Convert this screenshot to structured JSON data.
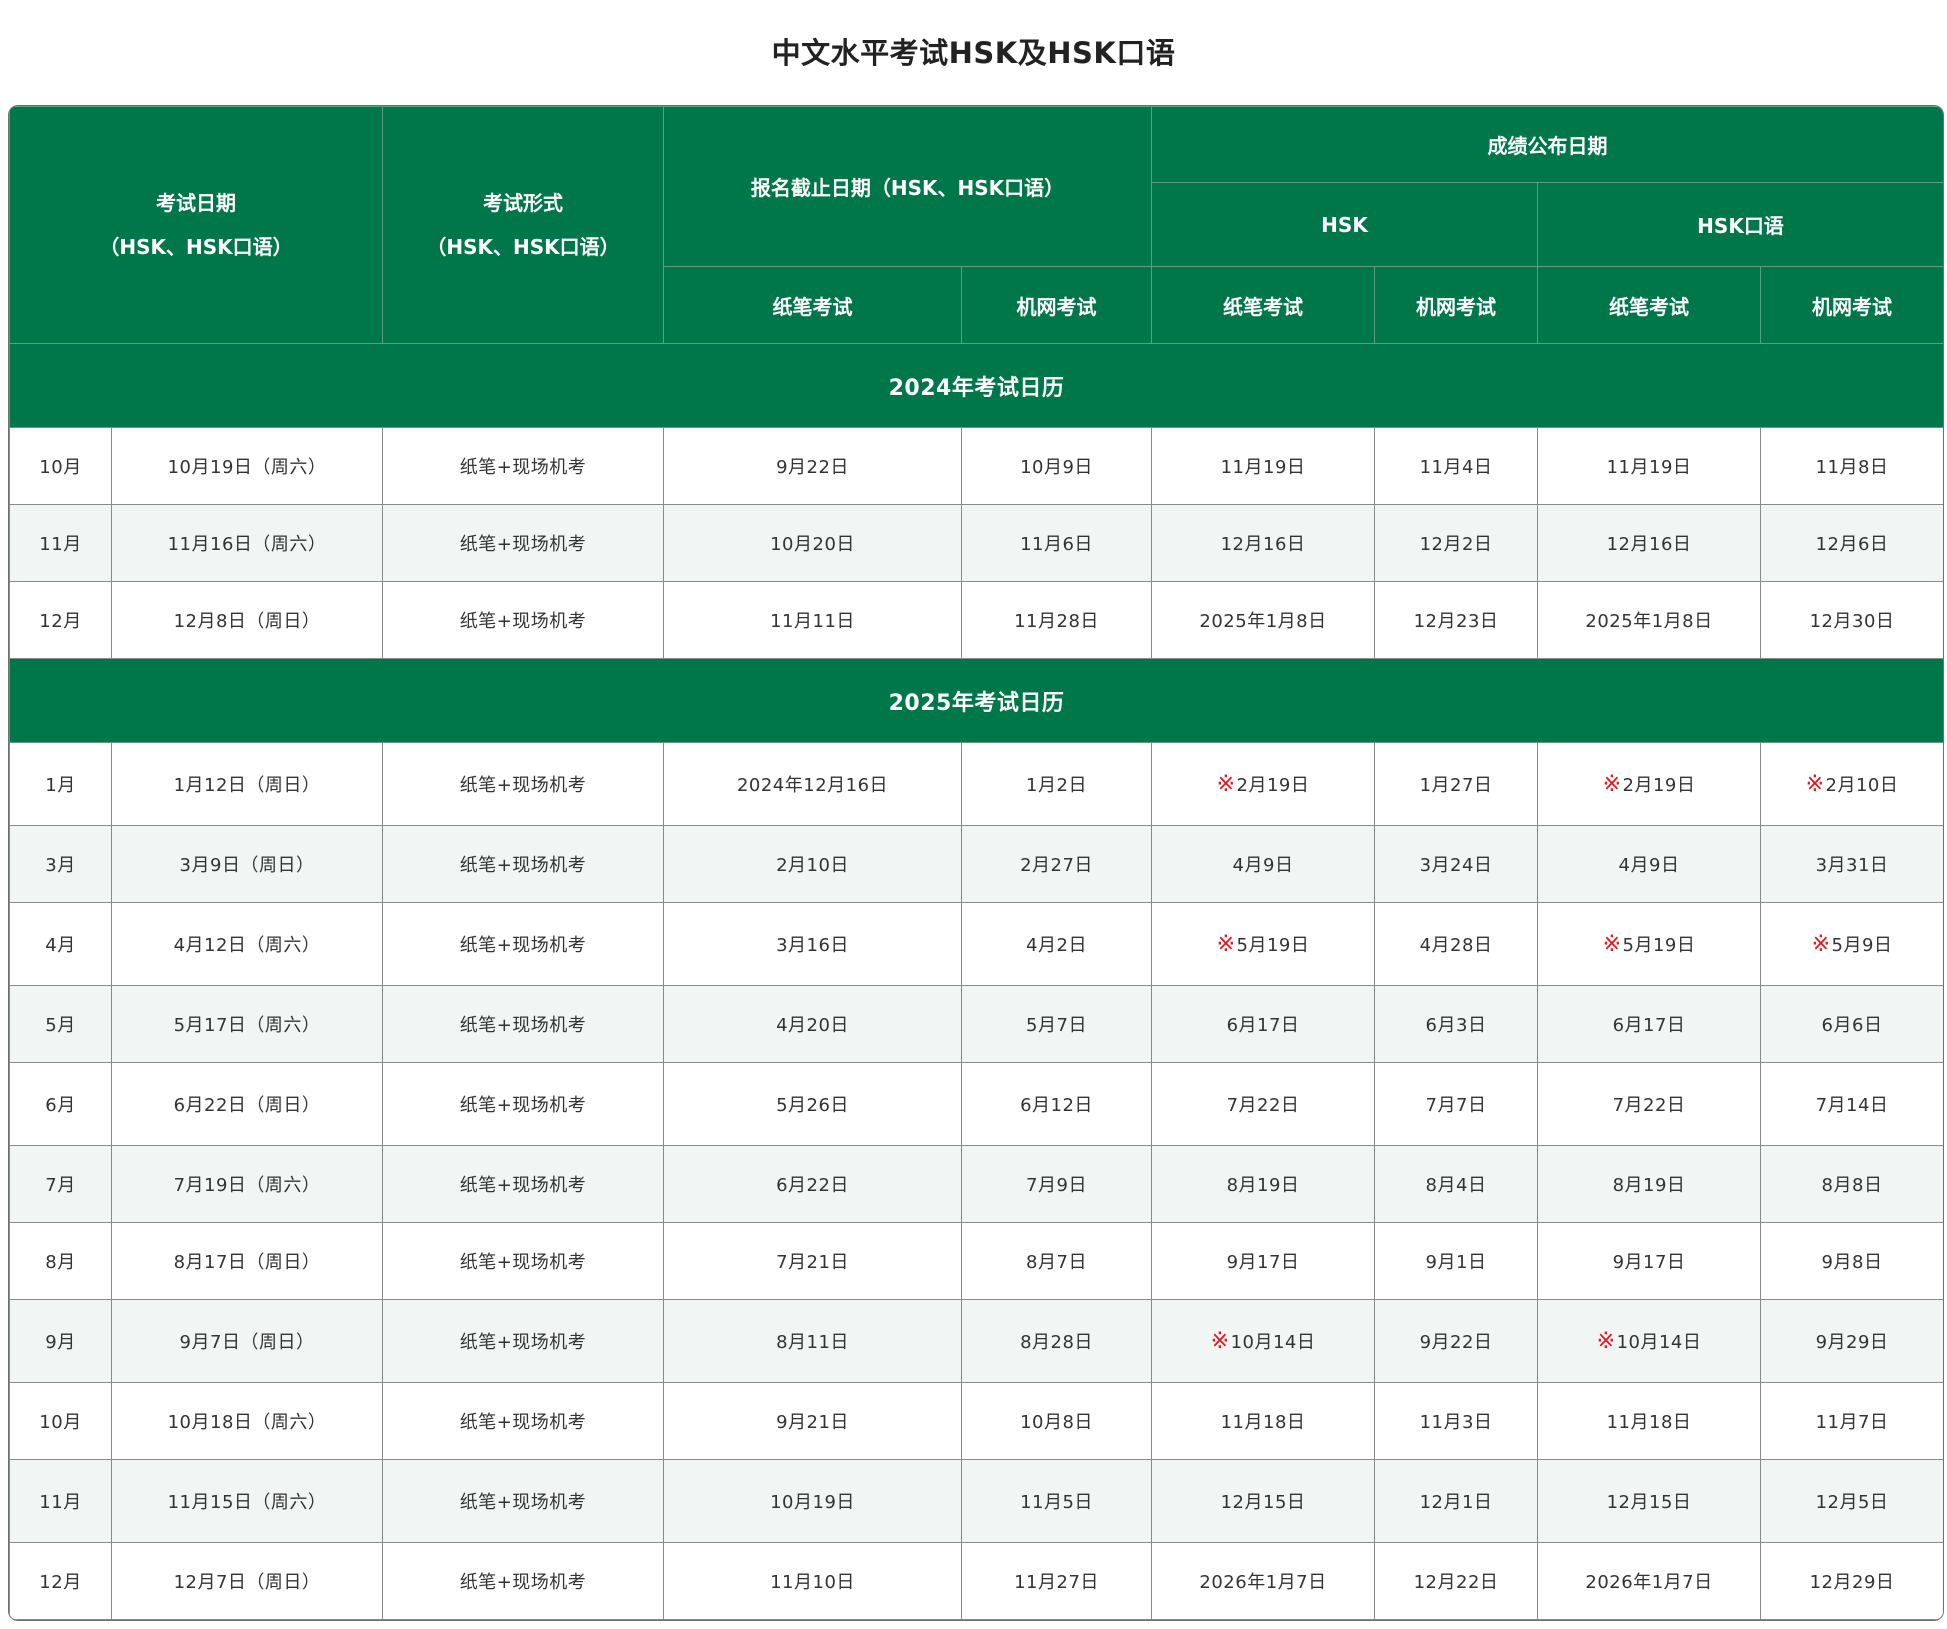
{
  "title": "中文水平考试HSK及HSK口语",
  "header": {
    "exam_date": "考试日期",
    "exam_date_sub": "（HSK、HSK口语）",
    "exam_format": "考试形式",
    "exam_format_sub": "（HSK、HSK口语）",
    "deadline": "报名截止日期（HSK、HSK口语）",
    "results": "成绩公布日期",
    "hsk": "HSK",
    "hsk_oral": "HSK口语",
    "paper": "纸笔考试",
    "online": "机网考试"
  },
  "sections": [
    {
      "year_label": "2024年考试日历",
      "rows": [
        {
          "month": "10月",
          "date": "10月19日（周六）",
          "format": "纸笔+现场机考",
          "dl_paper": "9月22日",
          "dl_online": "10月9日",
          "hsk_paper": "11月19日",
          "hsk_online": "11月4日",
          "oral_paper": "11月19日",
          "oral_online": "11月8日"
        },
        {
          "month": "11月",
          "date": "11月16日（周六）",
          "format": "纸笔+现场机考",
          "dl_paper": "10月20日",
          "dl_online": "11月6日",
          "hsk_paper": "12月16日",
          "hsk_online": "12月2日",
          "oral_paper": "12月16日",
          "oral_online": "12月6日"
        },
        {
          "month": "12月",
          "date": "12月8日（周日）",
          "format": "纸笔+现场机考",
          "dl_paper": "11月11日",
          "dl_online": "11月28日",
          "hsk_paper": "2025年1月8日",
          "hsk_online": "12月23日",
          "oral_paper": "2025年1月8日",
          "oral_online": "12月30日"
        }
      ]
    },
    {
      "year_label": "2025年考试日历",
      "rows": [
        {
          "month": "1月",
          "date": "1月12日（周日）",
          "format": "纸笔+现场机考",
          "dl_paper": "2024年12月16日",
          "dl_online": "1月2日",
          "hsk_paper": "※2月19日",
          "hsk_online": "1月27日",
          "oral_paper": "※2月19日",
          "oral_online": "※2月10日"
        },
        {
          "month": "3月",
          "date": "3月9日（周日）",
          "format": "纸笔+现场机考",
          "dl_paper": "2月10日",
          "dl_online": "2月27日",
          "hsk_paper": "4月9日",
          "hsk_online": "3月24日",
          "oral_paper": "4月9日",
          "oral_online": "3月31日"
        },
        {
          "month": "4月",
          "date": "4月12日（周六）",
          "format": "纸笔+现场机考",
          "dl_paper": "3月16日",
          "dl_online": "4月2日",
          "hsk_paper": "※5月19日",
          "hsk_online": "4月28日",
          "oral_paper": "※5月19日",
          "oral_online": "※5月9日"
        },
        {
          "month": "5月",
          "date": "5月17日（周六）",
          "format": "纸笔+现场机考",
          "dl_paper": "4月20日",
          "dl_online": "5月7日",
          "hsk_paper": "6月17日",
          "hsk_online": "6月3日",
          "oral_paper": "6月17日",
          "oral_online": "6月6日"
        },
        {
          "month": "6月",
          "date": "6月22日（周日）",
          "format": "纸笔+现场机考",
          "dl_paper": "5月26日",
          "dl_online": "6月12日",
          "hsk_paper": "7月22日",
          "hsk_online": "7月7日",
          "oral_paper": "7月22日",
          "oral_online": "7月14日"
        },
        {
          "month": "7月",
          "date": "7月19日（周六）",
          "format": "纸笔+现场机考",
          "dl_paper": "6月22日",
          "dl_online": "7月9日",
          "hsk_paper": "8月19日",
          "hsk_online": "8月4日",
          "oral_paper": "8月19日",
          "oral_online": "8月8日"
        },
        {
          "month": "8月",
          "date": "8月17日（周日）",
          "format": "纸笔+现场机考",
          "dl_paper": "7月21日",
          "dl_online": "8月7日",
          "hsk_paper": "9月17日",
          "hsk_online": "9月1日",
          "oral_paper": "9月17日",
          "oral_online": "9月8日"
        },
        {
          "month": "9月",
          "date": "9月7日（周日）",
          "format": "纸笔+现场机考",
          "dl_paper": "8月11日",
          "dl_online": "8月28日",
          "hsk_paper": "※10月14日",
          "hsk_online": "9月22日",
          "oral_paper": "※10月14日",
          "oral_online": "9月29日"
        },
        {
          "month": "10月",
          "date": "10月18日（周六）",
          "format": "纸笔+现场机考",
          "dl_paper": "9月21日",
          "dl_online": "10月8日",
          "hsk_paper": "11月18日",
          "hsk_online": "11月3日",
          "oral_paper": "11月18日",
          "oral_online": "11月7日"
        },
        {
          "month": "11月",
          "date": "11月15日（周六）",
          "format": "纸笔+现场机考",
          "dl_paper": "10月19日",
          "dl_online": "11月5日",
          "hsk_paper": "12月15日",
          "hsk_online": "12月1日",
          "oral_paper": "12月15日",
          "oral_online": "12月5日"
        },
        {
          "month": "12月",
          "date": "12月7日（周日）",
          "format": "纸笔+现场机考",
          "dl_paper": "11月10日",
          "dl_online": "11月27日",
          "hsk_paper": "2026年1月7日",
          "hsk_online": "12月22日",
          "oral_paper": "2026年1月7日",
          "oral_online": "12月29日"
        }
      ]
    }
  ],
  "colors": {
    "header_green": "#00774a",
    "alt_row": "#f1f6f4",
    "mark_red": "#e8141c"
  }
}
